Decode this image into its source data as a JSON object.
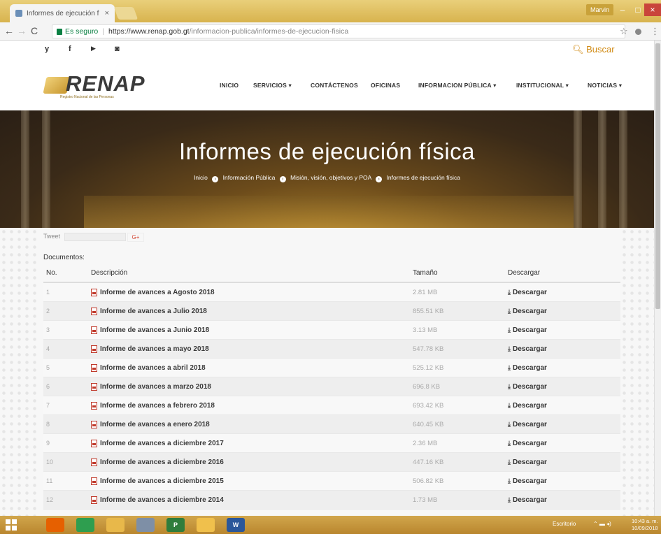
{
  "browser": {
    "tab_title": "Informes de ejecución f",
    "tab_close": "×",
    "user_badge": "Marvin",
    "window_min": "–",
    "window_max": "□",
    "window_close": "×",
    "secure_label": "Es seguro",
    "url_base": "https://www.renap.gob.gt",
    "url_path": "/informacion-publica/informes-de-ejecucion-fisica",
    "star_icon": "☆",
    "menu_icon": "⋮"
  },
  "site": {
    "social": [
      "y",
      "f",
      "▶",
      "◙"
    ],
    "search_label": "Buscar",
    "logo_text": "RENAP",
    "logo_sub": "Registro Nacional de las Personas",
    "nav": [
      {
        "label": "INICIO"
      },
      {
        "label": "SERVICIOS ▾"
      },
      {
        "label": "CONTÁCTENOS"
      },
      {
        "label": "OFICINAS"
      },
      {
        "label": "INFORMACION PÚBLICA ▾"
      },
      {
        "label": "INSTITUCIONAL ▾"
      },
      {
        "label": "NOTICIAS ▾"
      }
    ],
    "hero_title": "Informes de ejecución física",
    "breadcrumb": [
      "Inicio",
      "Información Pública",
      "Misión, visión, objetivos y POA",
      "Informes de ejecución física"
    ],
    "breadcrumb_sep": "›",
    "share": {
      "tweet": "Tweet",
      "gplus": "G+"
    },
    "documents_label": "Documentos:",
    "table": {
      "headers": {
        "no": "No.",
        "desc": "Descripción",
        "size": "Tamaño",
        "download": "Descargar"
      },
      "download_label": "Descargar",
      "rows": [
        {
          "no": "1",
          "desc": "Informe de avances a Agosto 2018",
          "size": "2.81 MB"
        },
        {
          "no": "2",
          "desc": "Informe de avances a Julio 2018",
          "size": "855.51 KB"
        },
        {
          "no": "3",
          "desc": "Informe de avances a Junio 2018",
          "size": "3.13 MB"
        },
        {
          "no": "4",
          "desc": "Informe de avances a mayo 2018",
          "size": "547.78 KB"
        },
        {
          "no": "5",
          "desc": "Informe de avances a abril 2018",
          "size": "525.12 KB"
        },
        {
          "no": "6",
          "desc": "Informe de avances a marzo 2018",
          "size": "696.8 KB"
        },
        {
          "no": "7",
          "desc": "Informe de avances a febrero 2018",
          "size": "693.42 KB"
        },
        {
          "no": "8",
          "desc": "Informe de avances a enero 2018",
          "size": "640.45 KB"
        },
        {
          "no": "9",
          "desc": "Informe de avances a diciembre 2017",
          "size": "2.36 MB"
        },
        {
          "no": "10",
          "desc": "Informe de avances a diciembre 2016",
          "size": "447.16 KB"
        },
        {
          "no": "11",
          "desc": "Informe de avances a diciembre 2015",
          "size": "506.82 KB"
        },
        {
          "no": "12",
          "desc": "Informe de avances a diciembre 2014",
          "size": "1.73 MB"
        }
      ]
    }
  },
  "taskbar": {
    "apps": [
      {
        "name": "firefox-icon",
        "label": "",
        "color": "#e66000"
      },
      {
        "name": "chrome-icon",
        "label": "",
        "color": "#2e9e4f"
      },
      {
        "name": "folder-app-icon",
        "label": "",
        "color": "#e8b84a"
      },
      {
        "name": "network-app-icon",
        "label": "",
        "color": "#7e8fa6"
      },
      {
        "name": "project-icon",
        "label": "P",
        "color": "#2f7d3c"
      },
      {
        "name": "explorer-icon",
        "label": "",
        "color": "#f0c04c"
      },
      {
        "name": "word-icon",
        "label": "W",
        "color": "#2b579a"
      }
    ],
    "tray_label": "Escritorio",
    "time": "10:43 a. m.",
    "date": "10/09/2018"
  }
}
